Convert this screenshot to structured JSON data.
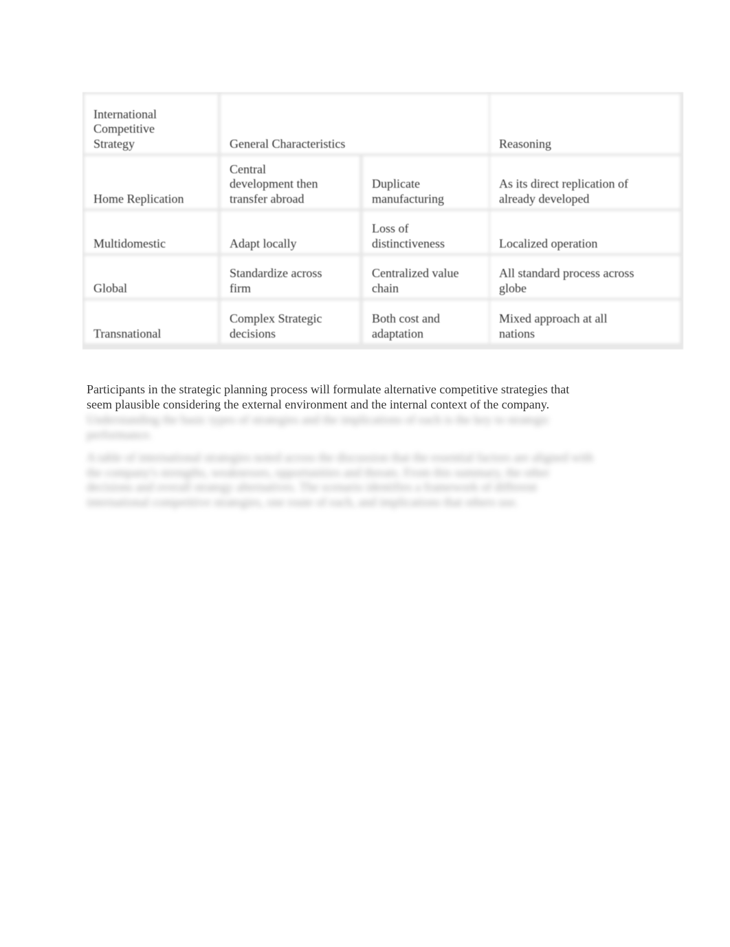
{
  "table": {
    "headers": {
      "strategy": "International\nCompetitive\nStrategy",
      "characteristics": "General Characteristics",
      "reasoning": "Reasoning"
    },
    "rows": [
      {
        "strategy": "Home Replication",
        "char1": "Central\ndevelopment then\ntransfer abroad",
        "char2": "Duplicate\nmanufacturing",
        "reasoning": "As its direct replication of\nalready developed"
      },
      {
        "strategy": "Multidomestic",
        "char1": "Adapt locally",
        "char2": "Loss of\ndistinctiveness",
        "reasoning": "Localized operation"
      },
      {
        "strategy": "Global",
        "char1": "Standardize across\nfirm",
        "char2": "Centralized value\nchain",
        "reasoning": "All standard process across\nglobe"
      },
      {
        "strategy": "Transnational",
        "char1": "Complex Strategic\ndecisions",
        "char2": "Both cost and\nadaptation",
        "reasoning": "Mixed approach at all\nnations"
      }
    ]
  },
  "paragraph": "Participants in the strategic planning process will formulate alternative competitive strategies that seem plausible considering the external environment and the internal context of the company.",
  "blurred_text": {
    "block1": "Understanding the basic types of strategies and the implications of each is the key to strategic performance.",
    "block2": "A table of international strategies noted across the discussion that the essential factors are aligned with the company's strengths, weaknesses, opportunities and threats. From this summary, the other decisions and overall strategy alternatives. The scenario identifies a framework of different international competitive strategies, one route of each, and implications that others use."
  }
}
